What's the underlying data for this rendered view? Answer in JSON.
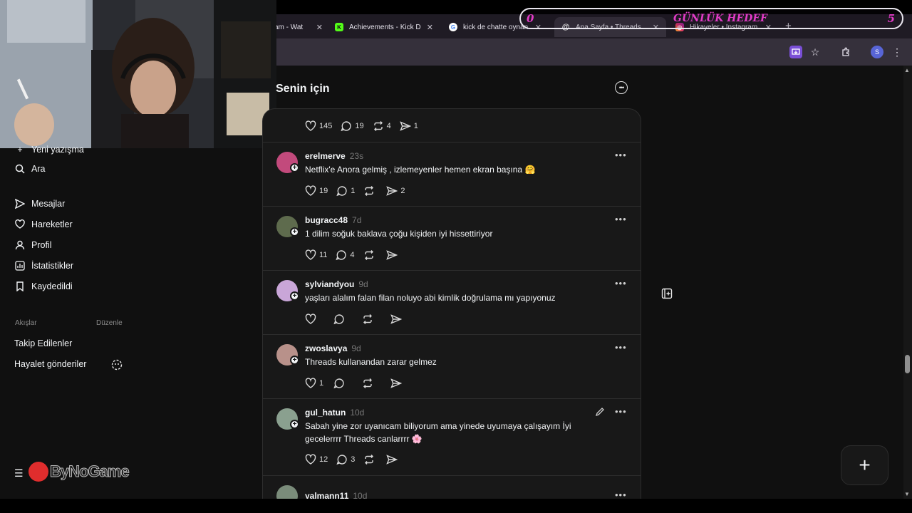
{
  "browser": {
    "tabs": [
      {
        "title": "am - Wat",
        "icon": "tab-icon-generic",
        "color": "#2f2a35"
      },
      {
        "title": "Achievements - Kick D",
        "icon": "kick-icon",
        "color": "#53fc18"
      },
      {
        "title": "kick de chatte oynan",
        "icon": "google-icon",
        "color": "#4285f4"
      },
      {
        "title": "Ana Sayfa • Threads",
        "icon": "threads-icon",
        "color": "#ffffff"
      },
      {
        "title": "Hikayeler • Instagram",
        "icon": "instagram-icon",
        "color": "#e1306c"
      }
    ],
    "profile_initial": "S"
  },
  "goal_overlay": {
    "left_value": "0",
    "label": "GÜNLÜK HEDEF",
    "right_value": "5"
  },
  "sidebar": {
    "new_thread": "Yeni yazışma",
    "items": [
      {
        "label": "Ara",
        "icon": "search-icon"
      },
      {
        "label": "Mesajlar",
        "icon": "send-icon"
      },
      {
        "label": "Hareketler",
        "icon": "heart-icon"
      },
      {
        "label": "Profil",
        "icon": "person-icon"
      },
      {
        "label": "İstatistikler",
        "icon": "stats-icon"
      },
      {
        "label": "Kaydedildi",
        "icon": "bookmark-icon"
      }
    ],
    "feeds_header": "Akışlar",
    "edit_label": "Düzenle",
    "feeds": [
      {
        "label": "Takip Edilenler"
      },
      {
        "label": "Hayalet gönderiler"
      }
    ],
    "watermark": "ByNoGame"
  },
  "feed": {
    "title": "Senin için",
    "first_post_stats": {
      "likes": "145",
      "replies": "19",
      "reposts": "4",
      "shares": "1"
    },
    "posts": [
      {
        "user": "erelmerve",
        "time": "23s",
        "text": "Netflix'e Anora gelmiş , izlemeyenler hemen ekran başına 🤗",
        "likes": "19",
        "replies": "1",
        "reposts": "",
        "shares": "2",
        "avatar_color": "#c24a7c"
      },
      {
        "user": "bugracc48",
        "time": "7d",
        "text": "1 dilim soğuk baklava çoğu kişiden iyi hissettiriyor",
        "likes": "11",
        "replies": "4",
        "reposts": "",
        "shares": "",
        "avatar_color": "#5e6b4d"
      },
      {
        "user": "sylviandyou",
        "time": "9d",
        "text": "yaşları alalım falan filan noluyo abi kimlik doğrulama mı yapıyonuz",
        "likes": "",
        "replies": "",
        "reposts": "",
        "shares": "",
        "avatar_color": "#c9a6d8"
      },
      {
        "user": "zwoslavya",
        "time": "9d",
        "text": "Threads kullanandan zarar gelmez",
        "likes": "1",
        "replies": "",
        "reposts": "",
        "shares": "",
        "avatar_color": "#b8918a"
      },
      {
        "user": "gul_hatun",
        "time": "10d",
        "text": "Sabah yine zor uyanıcam biliyorum ama yinede uyumaya çalışayım İyi gecelerrrr Threads canlarrrr 🌸",
        "likes": "12",
        "replies": "3",
        "reposts": "",
        "shares": "",
        "avatar_color": "#8aa08f"
      },
      {
        "user": "yalmann11",
        "time": "10d",
        "text": "",
        "likes": "",
        "replies": "",
        "reposts": "",
        "shares": "",
        "avatar_color": "#7a8c7a"
      }
    ]
  },
  "colors": {
    "background": "#101010",
    "card": "#181818",
    "border": "#2d2d2d",
    "accent": "#e23cc7"
  }
}
